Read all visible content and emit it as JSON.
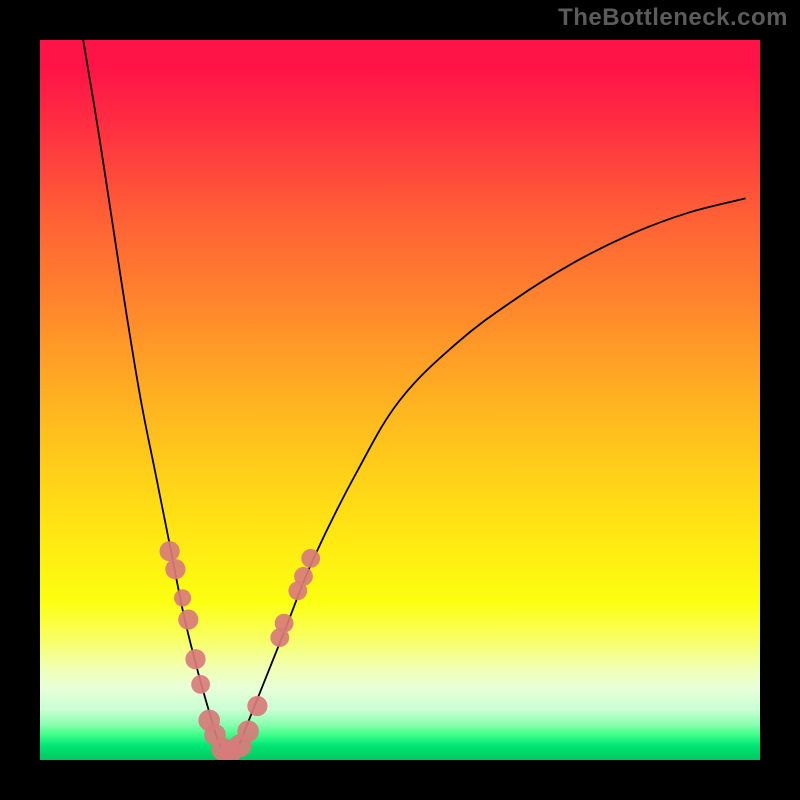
{
  "watermark": "TheBottleneck.com",
  "colors": {
    "frame": "#000000",
    "curve": "#000000",
    "dot": "#d87b7b",
    "gradient_top": "#ff1447",
    "gradient_bottom": "#00c85f",
    "watermark": "#5b5b5b"
  },
  "chart_data": {
    "type": "line",
    "title": "",
    "xlabel": "",
    "ylabel": "",
    "xlim": [
      0,
      100
    ],
    "ylim": [
      0,
      100
    ],
    "grid": false,
    "note": "Axis values are normalized 0-100 (no numeric labels shown in source). y=0 at bottom (green), y=100 at top (red). Curve is an asymmetric V-shaped valley reaching y≈0 near x≈25-27.",
    "series": [
      {
        "name": "bottleneck-curve",
        "x": [
          6,
          8,
          10,
          12,
          14,
          16,
          18,
          20,
          22,
          24,
          25,
          26,
          27,
          28,
          30,
          34,
          38,
          44,
          50,
          58,
          66,
          74,
          82,
          90,
          98
        ],
        "y": [
          100,
          88,
          75,
          62,
          50,
          40,
          30,
          20,
          12,
          5,
          2,
          1,
          1,
          3,
          8,
          18,
          28,
          40,
          50,
          58,
          64,
          69,
          73,
          76,
          78
        ]
      }
    ],
    "markers": [
      {
        "name": "highlighted-points",
        "note": "Salmon dots clustered near the valley and lower flanks of the curve.",
        "points": [
          {
            "x": 18.0,
            "y": 29.0,
            "r": 1.4
          },
          {
            "x": 18.8,
            "y": 26.5,
            "r": 1.4
          },
          {
            "x": 19.8,
            "y": 22.5,
            "r": 1.2
          },
          {
            "x": 20.6,
            "y": 19.5,
            "r": 1.4
          },
          {
            "x": 21.6,
            "y": 14.0,
            "r": 1.4
          },
          {
            "x": 22.3,
            "y": 10.5,
            "r": 1.3
          },
          {
            "x": 23.5,
            "y": 5.5,
            "r": 1.5
          },
          {
            "x": 24.3,
            "y": 3.5,
            "r": 1.5
          },
          {
            "x": 25.4,
            "y": 1.5,
            "r": 1.6
          },
          {
            "x": 26.5,
            "y": 1.2,
            "r": 1.6
          },
          {
            "x": 27.8,
            "y": 2.0,
            "r": 1.6
          },
          {
            "x": 28.9,
            "y": 4.0,
            "r": 1.5
          },
          {
            "x": 30.2,
            "y": 7.5,
            "r": 1.4
          },
          {
            "x": 33.3,
            "y": 17.0,
            "r": 1.3
          },
          {
            "x": 33.9,
            "y": 19.0,
            "r": 1.3
          },
          {
            "x": 35.8,
            "y": 23.5,
            "r": 1.3
          },
          {
            "x": 36.6,
            "y": 25.5,
            "r": 1.3
          },
          {
            "x": 37.6,
            "y": 28.0,
            "r": 1.3
          }
        ]
      }
    ]
  }
}
